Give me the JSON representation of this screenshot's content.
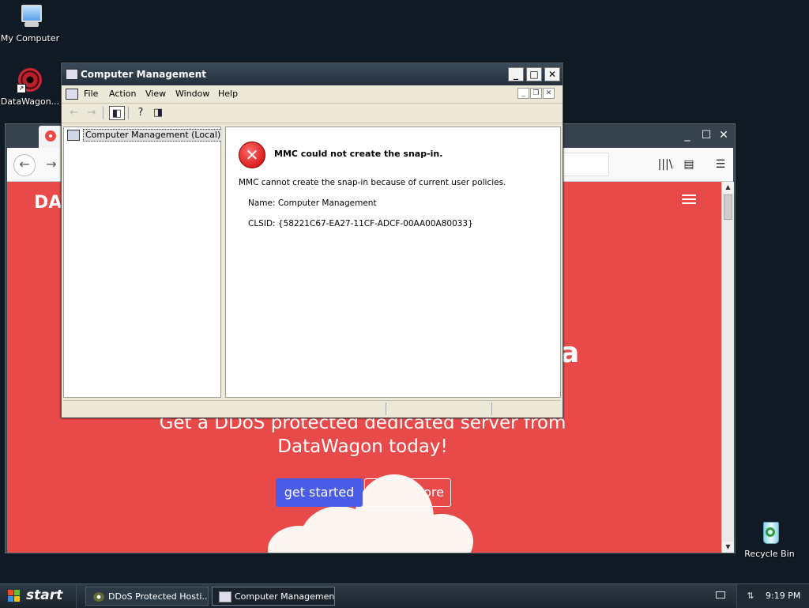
{
  "desktop": {
    "icons": [
      {
        "label": "My Computer"
      },
      {
        "label": "DataWagon..."
      },
      {
        "label": "Recycle Bin"
      }
    ]
  },
  "firefox": {
    "site": {
      "logo": "DAT",
      "heading_fragment": "a",
      "subtitle": "Get a DDoS protected dedicated server from DataWagon today!",
      "get_started": "get started",
      "learn_more": "ore"
    },
    "controls": {
      "minimize": "_",
      "maximize": "☐",
      "close": "✕"
    }
  },
  "cm": {
    "title": "Computer Management",
    "menu": [
      "File",
      "Action",
      "View",
      "Window",
      "Help"
    ],
    "tree_root": "Computer Management (Local)",
    "error": {
      "title": "MMC could not create the snap-in.",
      "message": "MMC cannot create the snap-in because of current user policies.",
      "name": "Name: Computer Management",
      "clsid": "CLSID: {58221C67-EA27-11CF-ADCF-00AA00A80033}"
    }
  },
  "taskbar": {
    "start": "start",
    "tasks": [
      {
        "label": "DDoS Protected Hosti..."
      },
      {
        "label": "Computer Management"
      }
    ],
    "clock": "9:19 PM"
  }
}
